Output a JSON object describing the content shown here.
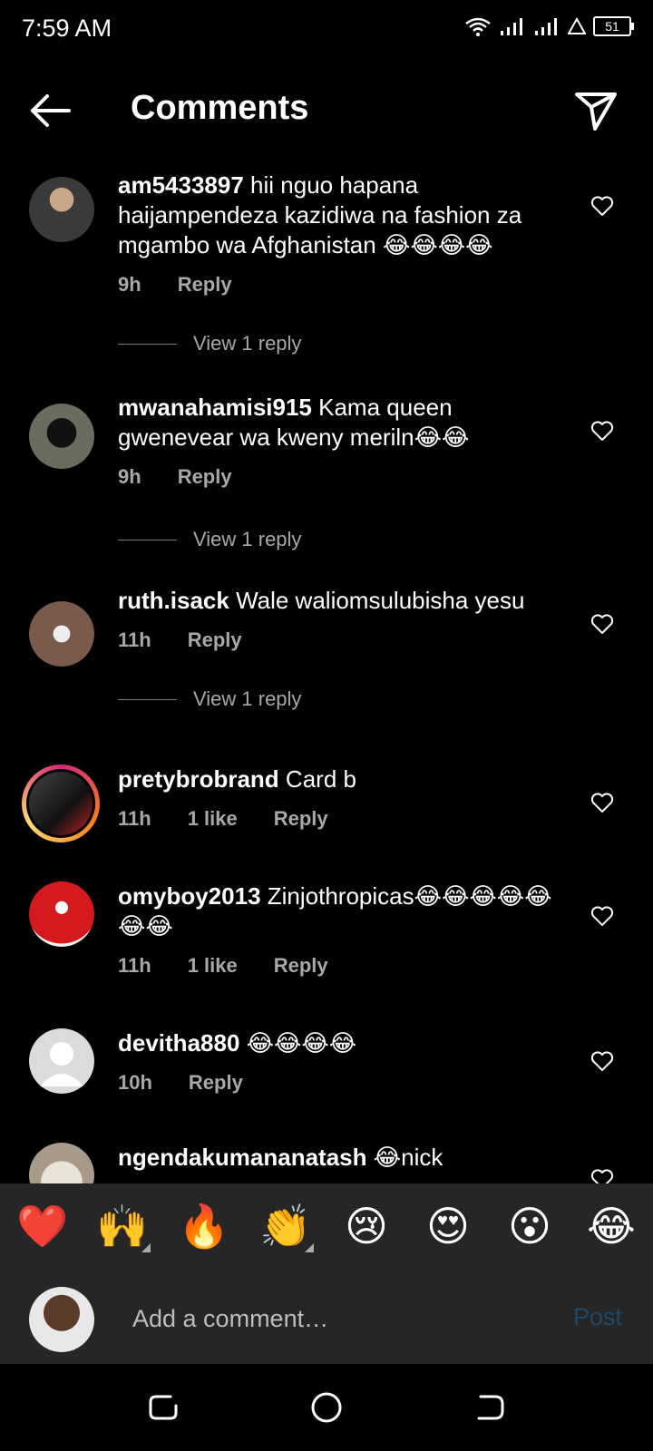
{
  "status": {
    "time": "7:59 AM",
    "battery": "51"
  },
  "header": {
    "title": "Comments"
  },
  "comments": [
    {
      "username": "am5433897",
      "text": "hii nguo hapana haijampendeza kazidiwa na fashion za mgambo wa Afghanistan 😂😂😂😂",
      "time": "9h",
      "likes": "",
      "reply_label": "Reply",
      "view_replies": "View 1 reply"
    },
    {
      "username": "mwanahamisi915",
      "text": "Kama queen gwenevear wa kweny meriln😂😂",
      "time": "9h",
      "likes": "",
      "reply_label": "Reply",
      "view_replies": "View 1 reply"
    },
    {
      "username": "ruth.isack",
      "text": "Wale waliomsulubisha yesu",
      "time": "11h",
      "likes": "",
      "reply_label": "Reply",
      "view_replies": "View 1 reply"
    },
    {
      "username": "pretybrobrand",
      "text": "Card b",
      "time": "11h",
      "likes": "1 like",
      "reply_label": "Reply"
    },
    {
      "username": "omyboy2013",
      "text": "Zinjothropicas😂😂😂😂😂😂😂",
      "time": "11h",
      "likes": "1 like",
      "reply_label": "Reply"
    },
    {
      "username": "devitha880",
      "text": "😂😂😂😂",
      "time": "10h",
      "likes": "",
      "reply_label": "Reply"
    },
    {
      "username": "ngendakumananatash",
      "text": "😂nick"
    }
  ],
  "emoji_bar": [
    "❤️",
    "🙌",
    "🔥",
    "👏",
    "😢",
    "😍",
    "😮",
    "😂"
  ],
  "input": {
    "placeholder": "Add a comment…",
    "post_label": "Post"
  },
  "colors": {
    "background": "#000000",
    "panel": "#262626",
    "meta_text": "#a8a8a8",
    "post_disabled": "#1c4a6e"
  }
}
